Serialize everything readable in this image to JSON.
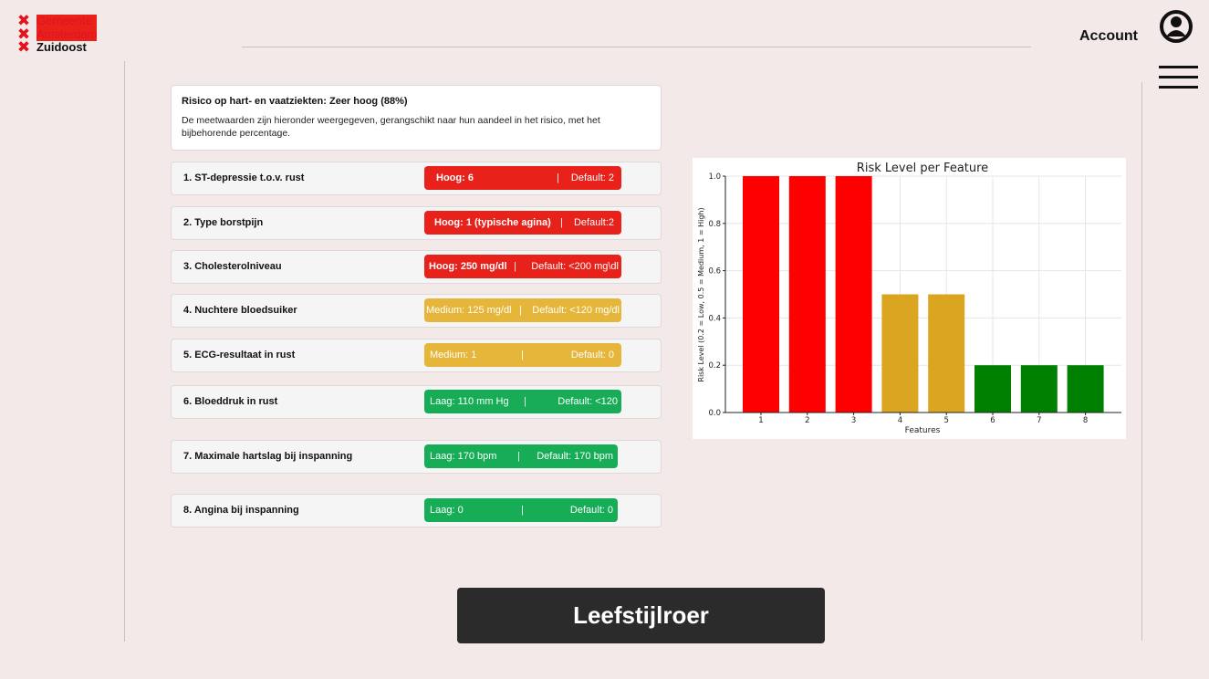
{
  "logo": {
    "line1": "Gemeente",
    "line2": "Amsterdam",
    "line3": "Zuidoost"
  },
  "header": {
    "account_label": "Account"
  },
  "icons": {
    "user": "user-circle-icon",
    "menu": "hamburger-menu-icon",
    "cross": "x-cross-icon"
  },
  "summary": {
    "title": "Risico op hart- en vaatziekten: Zeer hoog (88%)",
    "description": "De meetwaarden zijn hieronder weergegeven, gerangschikt naar hun aandeel in het risico, met het bijbehorende percentage."
  },
  "features": [
    {
      "label": "1. ST-depressie t.o.v. rust",
      "value": "Hoog: 6",
      "sep": "|",
      "default": "Default: 2",
      "status": "red"
    },
    {
      "label": "2. Type borstpijn",
      "value": "Hoog: 1 (typische agina)",
      "sep": "|",
      "default": "Default:2",
      "status": "red"
    },
    {
      "label": "3. Cholesterolniveau",
      "value": "Hoog: 250 mg/dl",
      "sep": "|",
      "default": "Default: <200 mg\\dl",
      "status": "red"
    },
    {
      "label": "4. Nuchtere bloedsuiker",
      "value": "Medium: 125 mg/dl",
      "sep": "|",
      "default": "Default: <120 mg/dl",
      "status": "amber"
    },
    {
      "label": "5. ECG-resultaat in rust",
      "value": "Medium: 1",
      "sep": "|",
      "default": "Default: 0",
      "status": "amber"
    },
    {
      "label": "6. Bloeddruk in rust",
      "value": "Laag: 110 mm Hg",
      "sep": "|",
      "default": "Default: <120",
      "status": "green"
    },
    {
      "label": "7. Maximale hartslag bij inspanning",
      "value": "Laag: 170 bpm",
      "sep": "|",
      "default": "Default: 170 bpm",
      "status": "green"
    },
    {
      "label": "8. Angina bij inspanning",
      "value": "Laag: 0",
      "sep": "|",
      "default": "Default: 0",
      "status": "green"
    }
  ],
  "colors": {
    "red": "#e8211b",
    "amber": "#e5b63a",
    "green": "#17ad57",
    "bar_red": "#ff0000",
    "bar_amber": "#daa520",
    "bar_green": "#008000"
  },
  "chart_data": {
    "type": "bar",
    "title": "Risk Level per Feature",
    "xlabel": "Features",
    "ylabel": "Risk Level (0.2 = Low, 0.5 = Medium, 1 = High)",
    "categories": [
      "1",
      "2",
      "3",
      "4",
      "5",
      "6",
      "7",
      "8"
    ],
    "values": [
      1.0,
      1.0,
      1.0,
      0.5,
      0.5,
      0.2,
      0.2,
      0.2
    ],
    "bar_colors": [
      "#ff0000",
      "#ff0000",
      "#ff0000",
      "#daa520",
      "#daa520",
      "#008000",
      "#008000",
      "#008000"
    ],
    "ylim": [
      0,
      1.0
    ],
    "yticks": [
      "0.0",
      "0.2",
      "0.4",
      "0.6",
      "0.8",
      "1.0"
    ],
    "grid": true
  },
  "cta": {
    "label": "Leefstijlroer"
  }
}
